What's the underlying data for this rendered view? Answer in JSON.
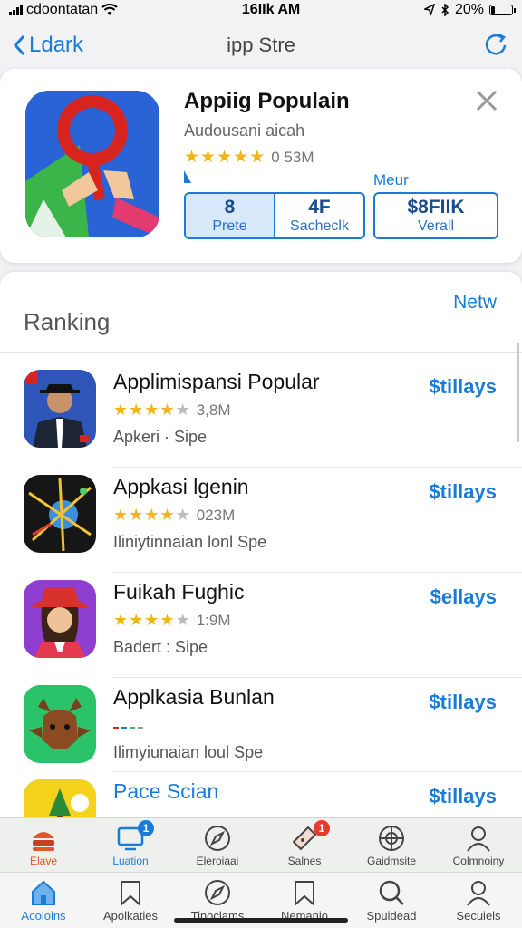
{
  "status_bar": {
    "carrier": "cdoontatan",
    "time": "16IIk AM",
    "battery": "20%",
    "battery_level": 0.2
  },
  "nav": {
    "back_label": "Ldark",
    "title": "ipp Stre"
  },
  "feature": {
    "title": "Appiig Populain",
    "subtitle": "Audousani aicah",
    "stars": 5,
    "rating_count": "0 53M",
    "more_label": "Meur",
    "stats": [
      {
        "value": "8",
        "label": "Prete"
      },
      {
        "value": "4F",
        "label": "Sacheclk"
      }
    ],
    "price": {
      "value": "$8FIIK",
      "label": "Verall"
    }
  },
  "ranking": {
    "title": "Ranking",
    "new_label": "Netw",
    "apps": [
      {
        "name": "Applimispansi Popular",
        "stars": 4,
        "count": "3,8M",
        "category": "Apkeri · Sipe",
        "price": "$tillays",
        "icon": "portrait-man-icon"
      },
      {
        "name": "Appkasi lgenin",
        "stars": 4,
        "count": "023M",
        "category": "Iliniytinnaian lonl Spe",
        "price": "$tillays",
        "icon": "spark-globe-icon"
      },
      {
        "name": "Fuikah Fughic",
        "stars": 4,
        "count": "1:9M",
        "category": "Badert : Sipe",
        "price": "$ellays",
        "icon": "portrait-woman-hat-icon"
      },
      {
        "name": "Applkasia Bunlan",
        "stars": 0,
        "count": "",
        "category": "Ilimyiunaian loul Spe",
        "price": "$tillays",
        "icon": "reindeer-icon"
      },
      {
        "name": "Pace Scian",
        "stars": 0,
        "count": "",
        "category": "",
        "price": "$tillays",
        "icon": "tree-icon"
      }
    ]
  },
  "tabs_upper": [
    {
      "label": "Elave",
      "icon": "burger-icon",
      "badge": ""
    },
    {
      "label": "Luation",
      "icon": "monitor-icon",
      "badge": "1"
    },
    {
      "label": "Eleroiaai",
      "icon": "compass-icon",
      "badge": ""
    },
    {
      "label": "Salnes",
      "icon": "ticket-icon",
      "badge": "1"
    },
    {
      "label": "Gaidmsite",
      "icon": "target-icon",
      "badge": ""
    },
    {
      "label": "Colmnoiny",
      "icon": "person-icon",
      "badge": ""
    }
  ],
  "tabs_lower": [
    {
      "label": "Acoloins",
      "icon": "home-icon"
    },
    {
      "label": "Apolkaties",
      "icon": "bookmark-icon"
    },
    {
      "label": "Tinoclams",
      "icon": "compass-icon"
    },
    {
      "label": "Nemanio",
      "icon": "bookmark-icon"
    },
    {
      "label": "Spuidead",
      "icon": "search-icon"
    },
    {
      "label": "Secuiels",
      "icon": "person-icon"
    }
  ],
  "colors": {
    "accent": "#1a7cd8",
    "star": "#f3b515",
    "active_tab": "#e2552d"
  }
}
